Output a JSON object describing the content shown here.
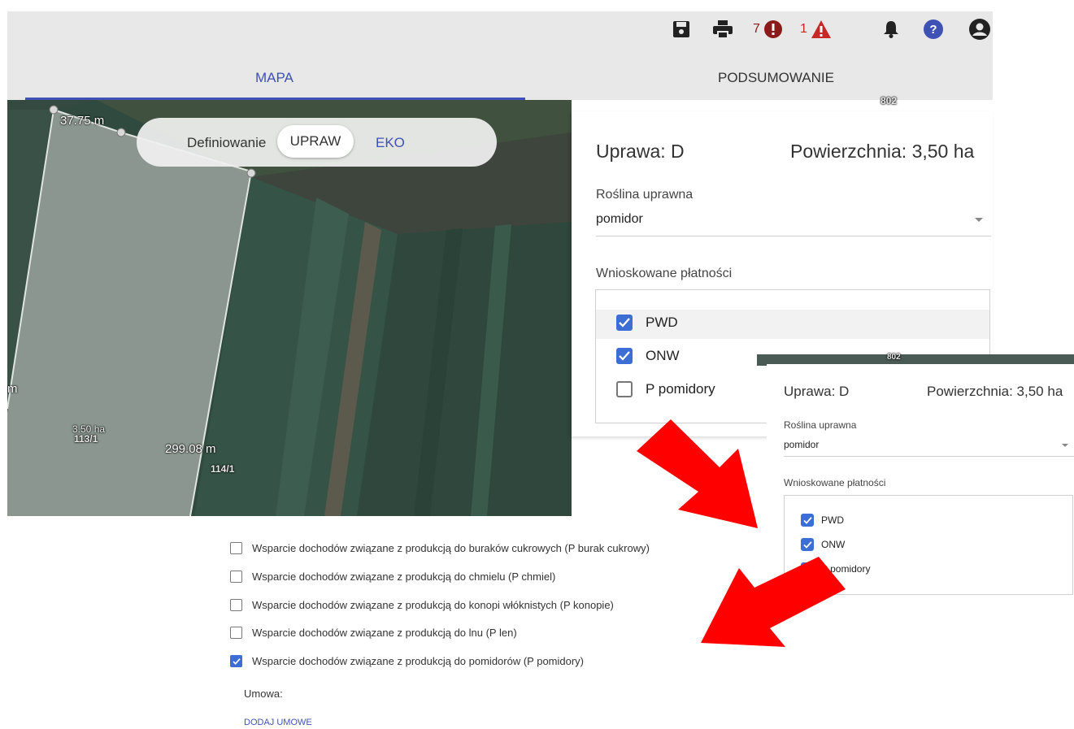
{
  "topbar": {
    "errors_count": "7",
    "warnings_count": "1",
    "icons": [
      "save-icon",
      "print-icon",
      "error-icon",
      "warning-icon",
      "bell-icon",
      "help-icon",
      "account-icon"
    ]
  },
  "tabs": {
    "mapa": "MAPA",
    "podsumowanie": "PODSUMOWANIE"
  },
  "map": {
    "label_top": "37.75 m",
    "label_area": "3.50 ha",
    "label_parcel_a": "113/1",
    "label_len": "299.08 m",
    "label_parcel_b": "114/1",
    "label_edge": "m",
    "label_top_right": "802"
  },
  "mode_pill": {
    "label": "Definiowanie",
    "upraw": "UPRAW",
    "eko": "EKO"
  },
  "panel": {
    "title": "Uprawa: D",
    "area": "Powierzchnia: 3,50 ha",
    "crop_label": "Roślina uprawna",
    "crop_value": "pomidor",
    "payments_label": "Wnioskowane płatności",
    "payments": [
      {
        "label": "PWD",
        "checked": true
      },
      {
        "label": "ONW",
        "checked": true
      },
      {
        "label": "P pomidory",
        "checked": false
      }
    ]
  },
  "inset": {
    "strip_label": "802",
    "title": "Uprawa: D",
    "area": "Powierzchnia: 3,50 ha",
    "crop_label": "Roślina uprawna",
    "crop_value": "pomidor",
    "payments_label": "Wnioskowane płatności",
    "payments": [
      {
        "label": "PWD",
        "checked": true
      },
      {
        "label": "ONW",
        "checked": true
      },
      {
        "label": "P pomidory",
        "checked": true
      }
    ]
  },
  "support_list": [
    {
      "label": "Wsparcie dochodów związane z produkcją do buraków cukrowych (P burak cukrowy)",
      "checked": false
    },
    {
      "label": "Wsparcie dochodów związane z produkcją do chmielu (P chmiel)",
      "checked": false
    },
    {
      "label": "Wsparcie dochodów związane z produkcją do konopi włóknistych (P konopie)",
      "checked": false
    },
    {
      "label": "Wsparcie dochodów związane z produkcją do lnu (P len)",
      "checked": false
    },
    {
      "label": "Wsparcie dochodów związane z produkcją do pomidorów (P pomidory)",
      "checked": true
    }
  ],
  "umowa_label": "Umowa:",
  "add_contract_label": "DODAJ UMOWE",
  "colors": {
    "accent": "#3f51b5",
    "checkbox": "#3d6ed6",
    "arrow": "#ff0000",
    "error": "#8b1a1a",
    "warning": "#c62828"
  }
}
